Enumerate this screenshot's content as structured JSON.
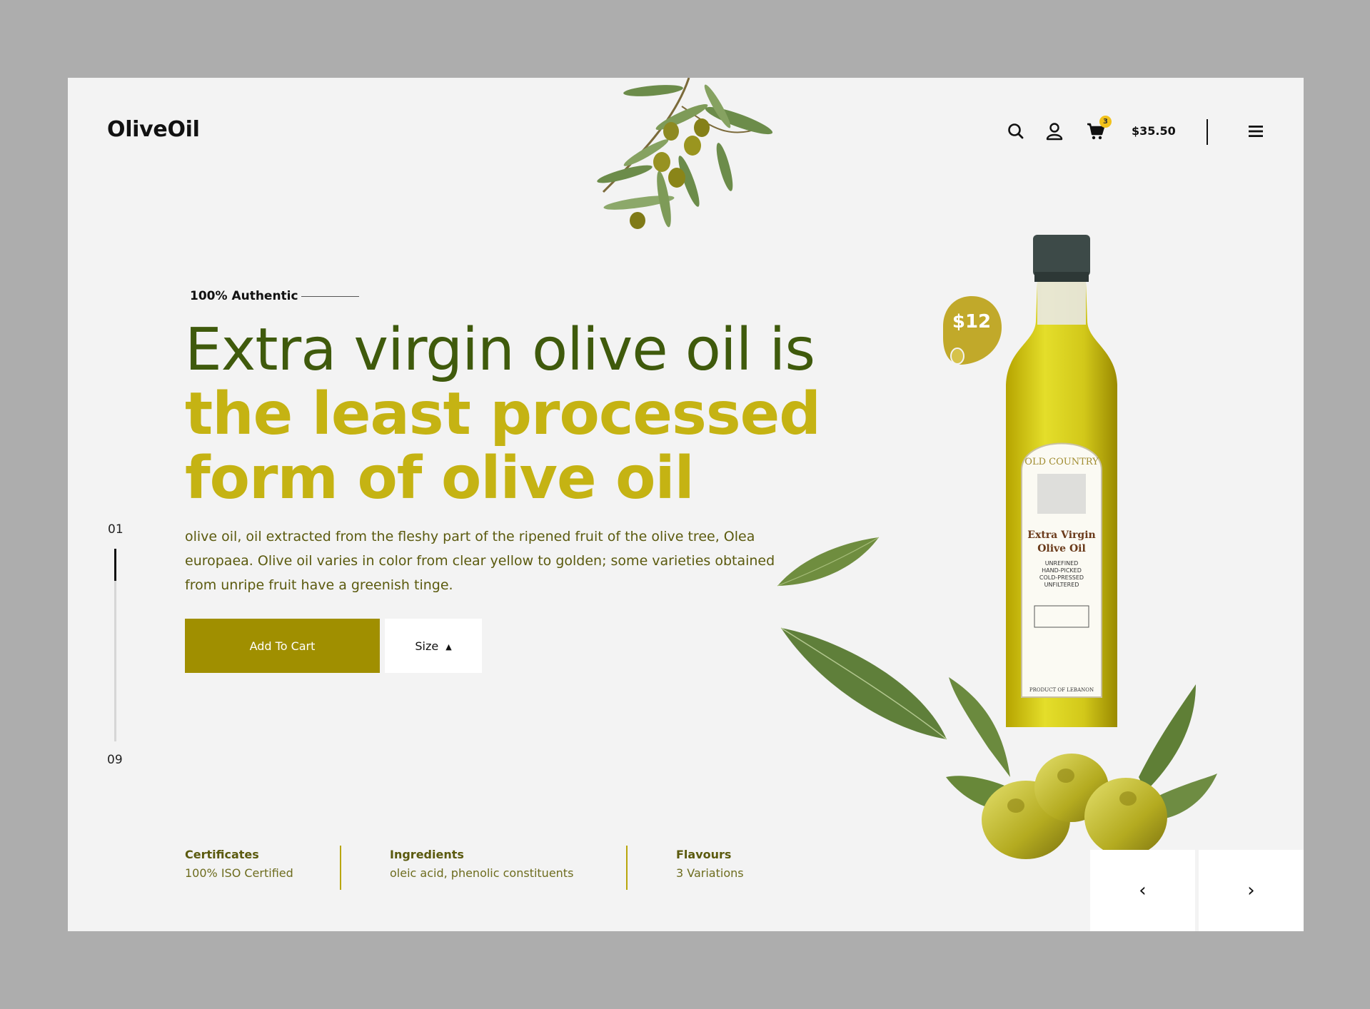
{
  "brand": {
    "logo": "OliveOil"
  },
  "header": {
    "cart_count": "3",
    "cart_total": "$35.50"
  },
  "hero": {
    "kicker": "100% Authentic",
    "headline_line1": "Extra virgin olive oil is",
    "headline_line2": "the least processed",
    "headline_line3": "form of olive oil",
    "description": "olive oil, oil extracted from the fleshy part of the ripened fruit of the olive tree, Olea europaea. Olive oil varies in color from clear yellow to golden; some varieties obtained from unripe fruit have a greenish tinge.",
    "add_to_cart": "Add To Cart",
    "size_label": "Size",
    "size_caret": "▲"
  },
  "product": {
    "price": "$12",
    "label_arc": "OLD COUNTRY",
    "label_title1": "Extra Virgin",
    "label_title2": "Olive Oil",
    "label_lines": [
      "UNREFINED",
      "HAND-PICKED",
      "COLD-PRESSED",
      "UNFILTERED"
    ],
    "label_origin": "PRODUCT OF LEBANON"
  },
  "pager": {
    "current": "01",
    "total": "09",
    "progress": 0.111
  },
  "info": [
    {
      "heading": "Certificates",
      "value": "100% ISO Certified"
    },
    {
      "heading": "Ingredients",
      "value": "oleic acid, phenolic constituents"
    },
    {
      "heading": "Flavours",
      "value": "3 Variations"
    }
  ],
  "controls": {
    "prev": "‹",
    "next": "›"
  },
  "colors": {
    "olive_dark": "#3f5a0c",
    "olive_gold": "#c5b313",
    "button_olive": "#a08f00",
    "badge_yellow": "#f2c21b"
  },
  "icons": [
    "search-icon",
    "user-icon",
    "cart-icon",
    "menu-icon"
  ]
}
